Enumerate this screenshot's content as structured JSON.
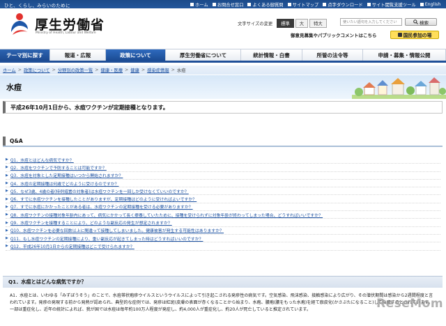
{
  "top_bar": {
    "tagline": "ひと、くらし、みらいのために",
    "links": [
      "ホーム",
      "お問合せ窓口",
      "よくある御質問",
      "サイトマップ",
      "点字ダウンロード",
      "サイト閲覧支援ツール",
      "English"
    ]
  },
  "logo": {
    "name": "厚生労働省",
    "sub": "Ministry of Health, Labour and Welfare"
  },
  "font_size": {
    "label": "文字サイズの変更",
    "options": [
      "標準",
      "大",
      "特大"
    ],
    "selected": "標準"
  },
  "search": {
    "placeholder": "使いたい語句を入力してください",
    "button": "検索"
  },
  "opinion_link": "御意見募集やパブリックコメントはこちら",
  "participate_button": "国民参加の場",
  "nav": {
    "items": [
      "テーマ別に探す",
      "報道・広報",
      "政策について",
      "厚生労働省について",
      "統計情報・白書",
      "所管の法令等",
      "申請・募集・情報公開"
    ],
    "active": "政策について"
  },
  "breadcrumb": {
    "items": [
      "ホーム",
      "政策について",
      "分野別の政策一覧",
      "健康・医療",
      "健康",
      "感染症情報",
      "水痘"
    ],
    "separator": ">"
  },
  "page_title": "水痘",
  "notice": "平成26年10月1日から、水痘ワクチンが定期接種となります。",
  "qa": {
    "heading": "Q&A",
    "items": [
      "Q1．水痘とはどんな病気ですか？",
      "Q2．水痘をワクチンで予防することは可能ですか？",
      "Q3．水痘を対象とした定期接種はいつから開始されますか？",
      "Q4．水痘の定期接種は何歳でどのように受けるのですか？",
      "Q5．なぜ3歳、4歳の者(特例措置の対象者)は水痘ワクチンを一回しか受けなくていいのですか？",
      "Q6．すでに水痘ワクチンを接種したことがありますが、定期接種はどのように受ければよいですか？",
      "Q7．すでに水痘にかかったことがある者は、水痘ワクチンの定期接種を受ける必要がありますか？",
      "Q8．水痘ワクチンの接種対象年齢内にあって、病気にかかって長く療養していたために、接種を受けられずに対象年齢が終わってしまった場合、どうすればいいですか？",
      "Q9．水痘ワクチンを接種することにより、どのような副反応の発生が想定されますか？",
      "Q10．水痘ワクチンを必要な回数以上に間違って接種してしまいました。健康被害が発生する可能性はありますか？",
      "Q11．もし水痘ワクチンの定期接種により、重い副反応が起きてしまった時はどうすればいいのですか？",
      "Q12．平成26年10月1日からの定期接種はどこで受けられますか？"
    ]
  },
  "q1": {
    "heading": "Q1．水痘とはどんな病気ですか？",
    "answer": "A1．水痘とは、いわゆる「みずぼうそう」のことで、水痘帯状疱疹ウイルスというウイルスによって引き起こされる発疹性の病気です。空気感染、飛沫感染、接触感染により広がり、その潜伏期間は感染から2週間程度と言われています。発疹の発現する前から発熱が認められ、典型的な症例では、発疹は紅斑(皮膚の表面が赤くなることから始まり、水疱、膿疱(膿をもった水疱)を経て痂皮化(かさぶたになること)して治癒するとされています。一部は重症化し、近年の統計によれば、我が国では水痘は毎年約100万人程度が発症し、約4,000人が重症化し、約20人が死亡していると推定されています。"
  },
  "watermark": "ReseMom",
  "colors": {
    "brand_blue": "#1f4f98",
    "link": "#1a4fa0",
    "participate": "#ffde5a"
  }
}
